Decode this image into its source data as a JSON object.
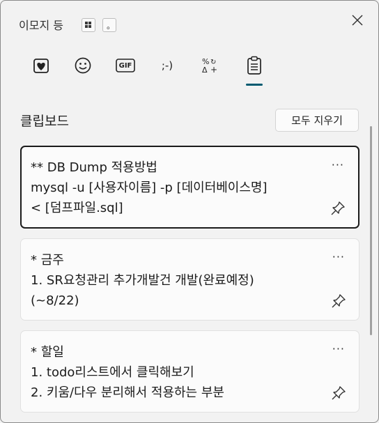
{
  "header": {
    "title": "이모지 등",
    "shortcut_win": "Windows key",
    "shortcut_period": "。"
  },
  "tabs": [
    {
      "id": "kaomoji-heart",
      "icon": "sticker-heart-icon"
    },
    {
      "id": "emoji",
      "icon": "smiley-icon"
    },
    {
      "id": "gif",
      "label": "GIF"
    },
    {
      "id": "kaomoji",
      "label": ";-)"
    },
    {
      "id": "symbols",
      "label": "%&#8317;+"
    },
    {
      "id": "clipboard",
      "icon": "clipboard-icon",
      "selected": true
    }
  ],
  "clipboard": {
    "title": "클립보드",
    "clear_all": "모두 지우기",
    "items": [
      {
        "text": "** DB Dump 적용방법\nmysql -u [사용자이름] -p [데이터베이스명]\n< [덤프파일.sql]",
        "selected": true
      },
      {
        "text": "* 금주\n1. SR요청관리 추가개발건 개발(완료예정)\n(~8/22)",
        "selected": false
      },
      {
        "text": "* 할일\n1. todo리스트에서 클릭해보기\n2. 키움/다우 분리해서 적용하는 부분",
        "selected": false
      }
    ],
    "more_label": "···"
  },
  "colors": {
    "accent": "#005a70",
    "background": "#f2f2f2",
    "card": "#fbfbfb"
  }
}
